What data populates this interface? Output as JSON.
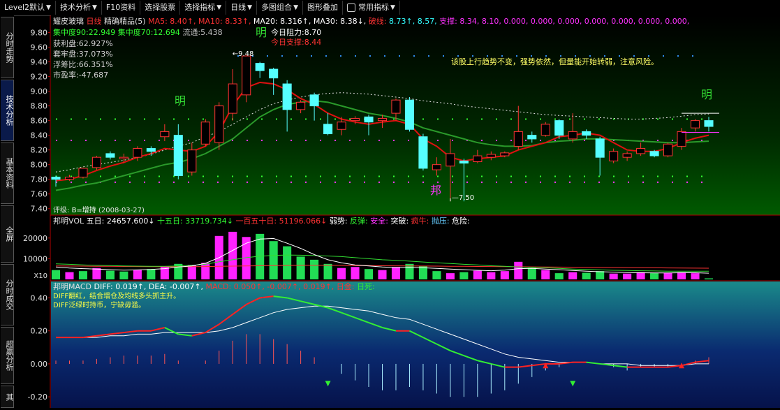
{
  "toolbar": {
    "items": [
      {
        "label": "Level2默认",
        "arrow": true
      },
      {
        "label": "技术分析",
        "arrow": true
      },
      {
        "label": "F10资料",
        "arrow": false
      },
      {
        "label": "选择股票",
        "arrow": false
      },
      {
        "label": "选择指标",
        "arrow": true
      },
      {
        "label": "日线",
        "arrow": true
      },
      {
        "label": "多图组合",
        "arrow": true
      },
      {
        "label": "图形叠加",
        "arrow": false
      },
      {
        "label": "常用指标",
        "arrow": true
      }
    ]
  },
  "sidebar": {
    "tabs": [
      {
        "label": "分时走势",
        "active": false
      },
      {
        "label": "技术分析",
        "active": true
      },
      {
        "label": "基本资料",
        "active": false
      },
      {
        "label": "全屏",
        "active": false
      },
      {
        "label": "分时成交",
        "active": false
      },
      {
        "label": "超赢分析",
        "active": false
      },
      {
        "label": "其",
        "active": false
      }
    ]
  },
  "main": {
    "stock_name": "耀皮玻璃",
    "period": "日线",
    "indicator": "精确精品(5)",
    "ma": [
      {
        "label": "MA5:",
        "value": "8.40",
        "arrow": "↑",
        "color": "#ff3333"
      },
      {
        "label": "MA10:",
        "value": "8.33",
        "arrow": "↑",
        "color": "#ff3333"
      },
      {
        "label": "MA20:",
        "value": "8.316",
        "arrow": "↑",
        "color": "#ffffff"
      },
      {
        "label": "MA30:",
        "value": "8.38",
        "arrow": "↓",
        "color": "#ffffff"
      }
    ],
    "break_label": "破线:",
    "break_values": [
      "8.73",
      "↑, 8.57,"
    ],
    "support_label": "支撑:",
    "support_values": "8.34, 8.10, 0.000, 0.000, 0.000, 0.000, 0.000, 0.000, 0.000,",
    "info": [
      {
        "label": "集中度90:",
        "value": "22.949",
        "color": "#33ff33"
      },
      {
        "label": "集中度70:",
        "value": "12.694",
        "color": "#33ff33"
      },
      {
        "label": "流通:",
        "value": "5.438",
        "color": "#c0c0c0"
      }
    ],
    "left_stats": [
      {
        "text": "获利盘:62.927%"
      },
      {
        "text": "套牢盘:37.073%"
      },
      {
        "text": "浮筹比:66.351%"
      },
      {
        "text": "市盈率:-47.687"
      }
    ],
    "today_resistance": "今日阻力:8.70",
    "today_support": "今日支撑:8.44",
    "comment": "该股上行趋势不变，强势依然，但量能开始转弱，注意风险。",
    "high_mark": "9.48",
    "low_mark": "7.50",
    "ming_label": "明",
    "bang_label": "邦",
    "rating": "评级: B=增持 (2008-03-27)",
    "price_ticks": [
      "9.80",
      "9.60",
      "9.40",
      "9.20",
      "9.00",
      "8.80",
      "8.60",
      "8.40",
      "8.20",
      "8.00",
      "7.80",
      "7.60",
      "7.40"
    ]
  },
  "vol": {
    "title": "邦明VOL",
    "items": [
      {
        "text": "五日: 24657.600",
        "color": "#ffffff",
        "arrow": "↓"
      },
      {
        "text": "十五日: 33719.734",
        "color": "#33ff33",
        "arrow": "↓"
      },
      {
        "text": "一百五十日: 51196.066",
        "color": "#ff3333",
        "arrow": "↓"
      },
      {
        "text": "弱势:",
        "color": "#ffffff"
      },
      {
        "text": "反弹:",
        "color": "#33ff33"
      },
      {
        "text": "安全:",
        "color": "#ff33ff"
      },
      {
        "text": "突破:",
        "color": "#ffffff"
      },
      {
        "text": "疯牛:",
        "color": "#ff3333"
      },
      {
        "text": "抛压:",
        "color": "#66ccff"
      },
      {
        "text": "危险:",
        "color": "#ffffff"
      }
    ],
    "ticks": [
      "20000",
      "10000"
    ],
    "unit": "X10"
  },
  "macd": {
    "title": "邦明MACD",
    "diff": "DIFF: 0.019↑,",
    "dea": "DEA: -0.007↑,",
    "macd": "MACD: 0.050↑,",
    "extra": "-0.007↑, 0.019↑,",
    "gold": "日金:",
    "dead": "日死:",
    "note1": "DIFF翻红，结合增仓及均线多头抓主升。",
    "note2": "DIFF泛绿时持币，宁缺毋滥。",
    "ticks": [
      "0.40",
      "0.20",
      "0.00",
      "-0.20"
    ]
  },
  "chart_data": {
    "type": "candlestick",
    "candles": [
      {
        "o": 7.83,
        "c": 7.8,
        "h": 7.85,
        "l": 7.7
      },
      {
        "o": 7.8,
        "c": 7.83,
        "h": 7.86,
        "l": 7.78
      },
      {
        "o": 7.83,
        "c": 7.95,
        "h": 7.96,
        "l": 7.81
      },
      {
        "o": 7.96,
        "c": 8.1,
        "h": 8.12,
        "l": 7.93
      },
      {
        "o": 8.15,
        "c": 8.1,
        "h": 8.18,
        "l": 8.07
      },
      {
        "o": 8.08,
        "c": 8.1,
        "h": 8.15,
        "l": 8.02
      },
      {
        "o": 8.1,
        "c": 8.22,
        "h": 8.25,
        "l": 8.05
      },
      {
        "o": 8.22,
        "c": 8.18,
        "h": 8.25,
        "l": 8.12
      },
      {
        "o": 8.38,
        "c": 8.45,
        "h": 8.55,
        "l": 8.32
      },
      {
        "o": 8.4,
        "c": 7.85,
        "h": 8.55,
        "l": 7.8
      },
      {
        "o": 7.9,
        "c": 8.2,
        "h": 8.3,
        "l": 7.85
      },
      {
        "o": 8.28,
        "c": 8.58,
        "h": 8.62,
        "l": 8.25
      },
      {
        "o": 8.3,
        "c": 8.8,
        "h": 8.85,
        "l": 8.2
      },
      {
        "o": 8.7,
        "c": 9.1,
        "h": 9.3,
        "l": 8.6
      },
      {
        "o": 8.95,
        "c": 9.48,
        "h": 9.5,
        "l": 8.85
      },
      {
        "o": 9.38,
        "c": 9.28,
        "h": 9.4,
        "l": 9.18
      },
      {
        "o": 9.3,
        "c": 9.18,
        "h": 9.32,
        "l": 8.95
      },
      {
        "o": 9.1,
        "c": 8.75,
        "h": 9.15,
        "l": 8.45
      },
      {
        "o": 8.75,
        "c": 8.85,
        "h": 8.88,
        "l": 8.7
      },
      {
        "o": 8.95,
        "c": 8.8,
        "h": 8.98,
        "l": 8.6
      },
      {
        "o": 8.55,
        "c": 8.42,
        "h": 8.7,
        "l": 8.4
      },
      {
        "o": 8.48,
        "c": 8.58,
        "h": 8.65,
        "l": 8.4
      },
      {
        "o": 8.6,
        "c": 8.63,
        "h": 8.66,
        "l": 8.55
      },
      {
        "o": 8.65,
        "c": 8.58,
        "h": 8.68,
        "l": 8.4
      },
      {
        "o": 8.6,
        "c": 8.63,
        "h": 8.68,
        "l": 8.5
      },
      {
        "o": 8.7,
        "c": 8.88,
        "h": 8.9,
        "l": 8.6
      },
      {
        "o": 8.88,
        "c": 8.48,
        "h": 8.92,
        "l": 8.45
      },
      {
        "o": 8.38,
        "c": 7.95,
        "h": 8.42,
        "l": 7.92
      },
      {
        "o": 7.93,
        "c": 8.0,
        "h": 8.1,
        "l": 7.85
      },
      {
        "o": 7.98,
        "c": 8.15,
        "h": 8.35,
        "l": 7.5
      },
      {
        "o": 8.05,
        "c": 8.02,
        "h": 8.08,
        "l": 7.5
      },
      {
        "o": 8.04,
        "c": 8.12,
        "h": 8.2,
        "l": 8.02
      },
      {
        "o": 8.1,
        "c": 8.14,
        "h": 8.18,
        "l": 8.06
      },
      {
        "o": 8.12,
        "c": 8.16,
        "h": 8.18,
        "l": 8.1
      },
      {
        "o": 8.25,
        "c": 8.45,
        "h": 8.8,
        "l": 8.2
      },
      {
        "o": 8.4,
        "c": 8.35,
        "h": 8.45,
        "l": 8.3
      },
      {
        "o": 8.4,
        "c": 8.55,
        "h": 8.58,
        "l": 8.38
      },
      {
        "o": 8.6,
        "c": 8.4,
        "h": 8.62,
        "l": 8.35
      },
      {
        "o": 8.35,
        "c": 8.45,
        "h": 8.7,
        "l": 8.3
      },
      {
        "o": 8.45,
        "c": 8.4,
        "h": 8.48,
        "l": 8.35
      },
      {
        "o": 8.35,
        "c": 8.1,
        "h": 8.38,
        "l": 7.85
      },
      {
        "o": 8.05,
        "c": 8.18,
        "h": 8.22,
        "l": 8.02
      },
      {
        "o": 8.1,
        "c": 8.15,
        "h": 8.18,
        "l": 8.05
      },
      {
        "o": 8.15,
        "c": 8.22,
        "h": 8.3,
        "l": 8.12
      },
      {
        "o": 8.18,
        "c": 8.12,
        "h": 8.2,
        "l": 8.1
      },
      {
        "o": 8.12,
        "c": 8.28,
        "h": 8.3,
        "l": 8.1
      },
      {
        "o": 8.25,
        "c": 8.45,
        "h": 8.5,
        "l": 8.2
      },
      {
        "o": 8.5,
        "c": 8.6,
        "h": 8.62,
        "l": 8.45
      },
      {
        "o": 8.6,
        "c": 8.52,
        "h": 8.65,
        "l": 8.45
      }
    ],
    "ma5": [
      7.78,
      7.8,
      7.85,
      7.92,
      7.98,
      8.03,
      8.1,
      8.15,
      8.22,
      8.2,
      8.18,
      8.25,
      8.45,
      8.8,
      9.05,
      9.12,
      9.1,
      9.02,
      8.9,
      8.82,
      8.7,
      8.62,
      8.58,
      8.55,
      8.58,
      8.6,
      8.55,
      8.35,
      8.25,
      8.1,
      8.05,
      8.08,
      8.1,
      8.12,
      8.2,
      8.25,
      8.3,
      8.38,
      8.4,
      8.43,
      8.4,
      8.3,
      8.2,
      8.18,
      8.18,
      8.22,
      8.3,
      8.36,
      8.4
    ],
    "ma20": [
      7.65,
      7.68,
      7.72,
      7.75,
      7.8,
      7.85,
      7.9,
      7.95,
      8.0,
      8.03,
      8.08,
      8.15,
      8.25,
      8.35,
      8.5,
      8.65,
      8.75,
      8.82,
      8.85,
      8.87,
      8.85,
      8.8,
      8.75,
      8.7,
      8.67,
      8.63,
      8.58,
      8.5,
      8.45,
      8.4,
      8.35,
      8.3,
      8.27,
      8.25,
      8.25,
      8.26,
      8.3,
      8.32,
      8.33,
      8.35,
      8.35,
      8.34,
      8.33,
      8.32,
      8.31,
      8.3,
      8.3,
      8.31,
      8.32
    ],
    "ma_dash": [
      7.9,
      7.93,
      7.97,
      8.0,
      8.03,
      8.06,
      8.1,
      8.14,
      8.2,
      8.25,
      8.3,
      8.38,
      8.45,
      8.55,
      8.65,
      8.75,
      8.83,
      8.88,
      8.92,
      8.95,
      8.97,
      8.98,
      8.97,
      8.96,
      8.94,
      8.92,
      8.9,
      8.87,
      8.85,
      8.83,
      8.8,
      8.78,
      8.76,
      8.74,
      8.72,
      8.7,
      8.68,
      8.67,
      8.66,
      8.65,
      8.64,
      8.63,
      8.62,
      8.62,
      8.63,
      8.64,
      8.66,
      8.68,
      8.69
    ],
    "volume": [
      4500,
      3500,
      4000,
      5500,
      4200,
      3800,
      4600,
      5000,
      6200,
      7500,
      7000,
      8000,
      21000,
      23000,
      20500,
      22000,
      18500,
      16000,
      11000,
      9500,
      7500,
      5500,
      6000,
      5000,
      4500,
      6000,
      7500,
      6500,
      4000,
      3000,
      3500,
      4200,
      3500,
      4000,
      8500,
      5500,
      4500,
      3000,
      3500,
      3200,
      4000,
      2800,
      2800,
      3500,
      3000,
      3200,
      3500,
      3000,
      500
    ],
    "vol_up": [
      false,
      true,
      false,
      true,
      false,
      false,
      true,
      false,
      true,
      false,
      true,
      true,
      true,
      true,
      true,
      false,
      false,
      false,
      false,
      false,
      false,
      true,
      true,
      false,
      true,
      true,
      false,
      false,
      false,
      true,
      false,
      true,
      true,
      true,
      true,
      false,
      true,
      false,
      true,
      false,
      false,
      true,
      true,
      true,
      false,
      true,
      true,
      true,
      false
    ],
    "vol_ma5": [
      6000,
      5500,
      5200,
      5000,
      4700,
      4500,
      4600,
      4800,
      5200,
      6000,
      6500,
      7800,
      10500,
      14000,
      17500,
      19500,
      19800,
      17500,
      15000,
      12000,
      9500,
      8000,
      7000,
      6500,
      6000,
      5700,
      5800,
      5600,
      5300,
      5000,
      4700,
      4400,
      4200,
      4500,
      5200,
      5300,
      5000,
      4700,
      4300,
      4000,
      3700,
      3500,
      3300,
      3200,
      3100,
      3100,
      3200,
      3200,
      3000
    ],
    "vol_ma15": [
      7500,
      7300,
      7000,
      6800,
      6700,
      6500,
      6400,
      6300,
      6300,
      6500,
      6800,
      7300,
      8500,
      9500,
      10500,
      11200,
      11600,
      11800,
      11700,
      11500,
      11300,
      11000,
      10500,
      10000,
      9500,
      9200,
      8800,
      8400,
      8000,
      7700,
      7300,
      7000,
      6600,
      6300,
      6000,
      5800,
      5600,
      5300,
      5000,
      4800,
      4600,
      4400,
      4300,
      4200,
      4100,
      4000,
      4000,
      4000,
      4000
    ],
    "vol_ma150": [
      6500,
      6450,
      6400,
      6350,
      6300,
      6250,
      6200,
      6150,
      6100,
      6100,
      6150,
      6200,
      6300,
      6400,
      6500,
      6600,
      6700,
      6750,
      6800,
      6800,
      6800,
      6750,
      6700,
      6650,
      6600,
      6550,
      6500,
      6450,
      6400,
      6350,
      6300,
      6250,
      6200,
      6150,
      6100,
      6050,
      6000,
      5950,
      5900,
      5850,
      5800,
      5750,
      5700,
      5650,
      5600,
      5550,
      5500,
      5450,
      5400
    ],
    "diff": [
      0.16,
      0.16,
      0.16,
      0.17,
      0.18,
      0.19,
      0.2,
      0.2,
      0.22,
      0.18,
      0.17,
      0.19,
      0.24,
      0.3,
      0.36,
      0.4,
      0.41,
      0.4,
      0.38,
      0.36,
      0.34,
      0.31,
      0.28,
      0.25,
      0.22,
      0.2,
      0.2,
      0.16,
      0.12,
      0.08,
      0.05,
      0.02,
      0.0,
      -0.02,
      -0.02,
      -0.01,
      0.0,
      0.0,
      0.01,
      0.01,
      0.0,
      -0.01,
      -0.02,
      -0.02,
      -0.02,
      -0.02,
      -0.01,
      0.01,
      0.02
    ],
    "dea": [
      0.16,
      0.16,
      0.16,
      0.16,
      0.17,
      0.17,
      0.18,
      0.18,
      0.19,
      0.19,
      0.19,
      0.19,
      0.2,
      0.22,
      0.25,
      0.28,
      0.31,
      0.33,
      0.34,
      0.35,
      0.35,
      0.34,
      0.33,
      0.32,
      0.3,
      0.28,
      0.27,
      0.24,
      0.21,
      0.18,
      0.15,
      0.12,
      0.09,
      0.06,
      0.04,
      0.03,
      0.02,
      0.01,
      0.01,
      0.01,
      0.0,
      0.0,
      0.0,
      -0.01,
      -0.01,
      -0.01,
      -0.01,
      0.0,
      0.0
    ],
    "macd_bar": [
      0.02,
      0.02,
      0.02,
      0.03,
      0.04,
      0.05,
      0.05,
      0.05,
      0.06,
      0.02,
      0.0,
      0.02,
      0.08,
      0.14,
      0.18,
      0.18,
      0.15,
      0.12,
      0.08,
      0.04,
      0.0,
      -0.06,
      -0.1,
      -0.14,
      -0.16,
      -0.16,
      -0.14,
      -0.16,
      -0.18,
      -0.2,
      -0.2,
      -0.2,
      -0.18,
      -0.16,
      -0.12,
      -0.08,
      -0.04,
      -0.02,
      0.0,
      0.0,
      0.0,
      -0.02,
      -0.04,
      -0.02,
      -0.02,
      -0.02,
      0.0,
      0.02,
      0.04
    ],
    "price_range": [
      7.35,
      9.9
    ],
    "vol_range": [
      0,
      26000
    ],
    "macd_range": [
      -0.25,
      0.44
    ]
  }
}
